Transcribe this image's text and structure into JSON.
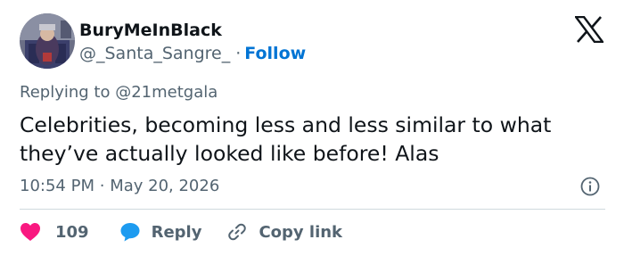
{
  "author": {
    "display_name": "BuryMeInBlack",
    "handle": "@_Santa_Sangre_",
    "separator": "·",
    "follow_label": "Follow"
  },
  "logo_icon": "x-logo-icon",
  "reply_context": {
    "prefix": "Replying to",
    "mention": "@21metgala"
  },
  "tweet": {
    "text": "Celebrities, becoming less and less similar to what they’ve actually looked like before! Alas"
  },
  "meta": {
    "time": "10:54 PM",
    "separator": "·",
    "date": "May 20, 2026",
    "info_icon": "info-icon"
  },
  "actions": {
    "like_count": "109",
    "like_icon": "heart-icon",
    "reply_label": "Reply",
    "reply_icon": "speech-bubble-icon",
    "copy_label": "Copy link",
    "copy_icon": "link-icon"
  },
  "colors": {
    "text": "#0f1419",
    "secondary": "#536471",
    "follow": "#0074d4",
    "like": "#f91880",
    "reply": "#1d9bf0",
    "divider": "#cfd9de"
  }
}
